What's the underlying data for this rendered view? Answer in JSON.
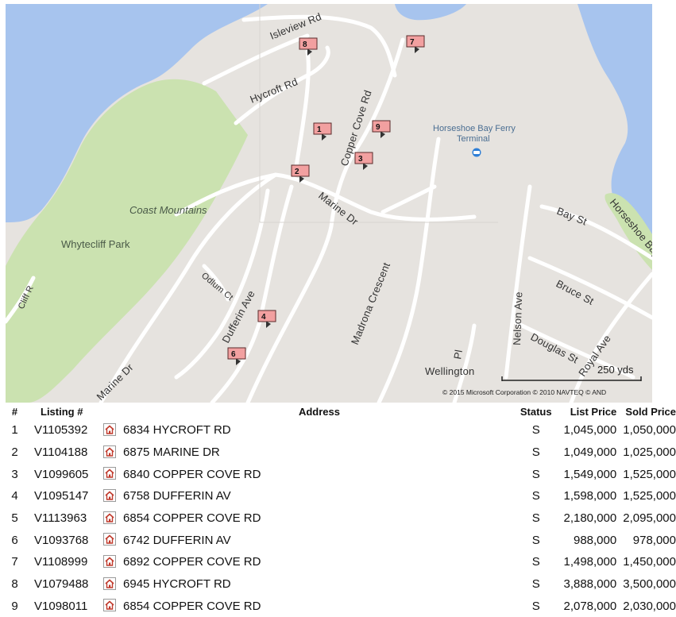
{
  "map": {
    "labels": {
      "isleview": "Isleview Rd",
      "hycroft": "Hycroft Rd",
      "copper_cove": "Copper Cove Rd",
      "ferry_line1": "Horseshoe Bay Ferry",
      "ferry_line2": "Terminal",
      "coast_mountains": "Coast Mountains",
      "whytecliff": "Whytecliff Park",
      "marine_dr_upper": "Marine Dr",
      "marine_dr_lower": "Marine Dr",
      "bay_st": "Bay St",
      "horseshoe_bay": "Horseshoe Bay",
      "odlum": "Odlum Ct",
      "cliff": "Cliff R",
      "dufferin": "Dufferin Ave",
      "madrona": "Madrona Crescent",
      "bruce": "Bruce St",
      "nelson": "Nelson Ave",
      "douglas": "Douglas St",
      "royal": "Royal Ave",
      "wellington": "Wellington",
      "wellington_pl": "Pl"
    },
    "scale_label": "250 yds",
    "copyright": "© 2015 Microsoft Corporation   © 2010 NAVTEQ   © AND",
    "pins": [
      "1",
      "2",
      "3",
      "4",
      "6",
      "7",
      "8",
      "9"
    ],
    "colors": {
      "water": "#a7c4ee",
      "park": "#cbe2b0",
      "land": "#e6e3df",
      "road": "#ffffff",
      "pin": "#f2a0a0"
    },
    "icons": {
      "pin": "listing-flag-icon",
      "ferry": "ferry-icon"
    }
  },
  "table": {
    "headers": {
      "num": "#",
      "listing": "Listing #",
      "address": "Address",
      "status": "Status",
      "list_price": "List Price",
      "sold_price": "Sold Price"
    },
    "rows": [
      {
        "num": "1",
        "listing": "V1105392",
        "address": "6834 HYCROFT RD",
        "status": "S",
        "list_price": "1,045,000",
        "sold_price": "1,050,000"
      },
      {
        "num": "2",
        "listing": "V1104188",
        "address": "6875 MARINE DR",
        "status": "S",
        "list_price": "1,049,000",
        "sold_price": "1,025,000"
      },
      {
        "num": "3",
        "listing": "V1099605",
        "address": "6840 COPPER COVE RD",
        "status": "S",
        "list_price": "1,549,000",
        "sold_price": "1,525,000"
      },
      {
        "num": "4",
        "listing": "V1095147",
        "address": "6758 DUFFERIN AV",
        "status": "S",
        "list_price": "1,598,000",
        "sold_price": "1,525,000"
      },
      {
        "num": "5",
        "listing": "V1113963",
        "address": "6854 COPPER COVE RD",
        "status": "S",
        "list_price": "2,180,000",
        "sold_price": "2,095,000"
      },
      {
        "num": "6",
        "listing": "V1093768",
        "address": "6742 DUFFERIN AV",
        "status": "S",
        "list_price": "988,000",
        "sold_price": "978,000"
      },
      {
        "num": "7",
        "listing": "V1108999",
        "address": "6892 COPPER COVE RD",
        "status": "S",
        "list_price": "1,498,000",
        "sold_price": "1,450,000"
      },
      {
        "num": "8",
        "listing": "V1079488",
        "address": "6945 HYCROFT RD",
        "status": "S",
        "list_price": "3,888,000",
        "sold_price": "3,500,000"
      },
      {
        "num": "9",
        "listing": "V1098011",
        "address": "6854 COPPER COVE RD",
        "status": "S",
        "list_price": "2,078,000",
        "sold_price": "2,030,000"
      }
    ],
    "row_icon": "home-icon"
  }
}
